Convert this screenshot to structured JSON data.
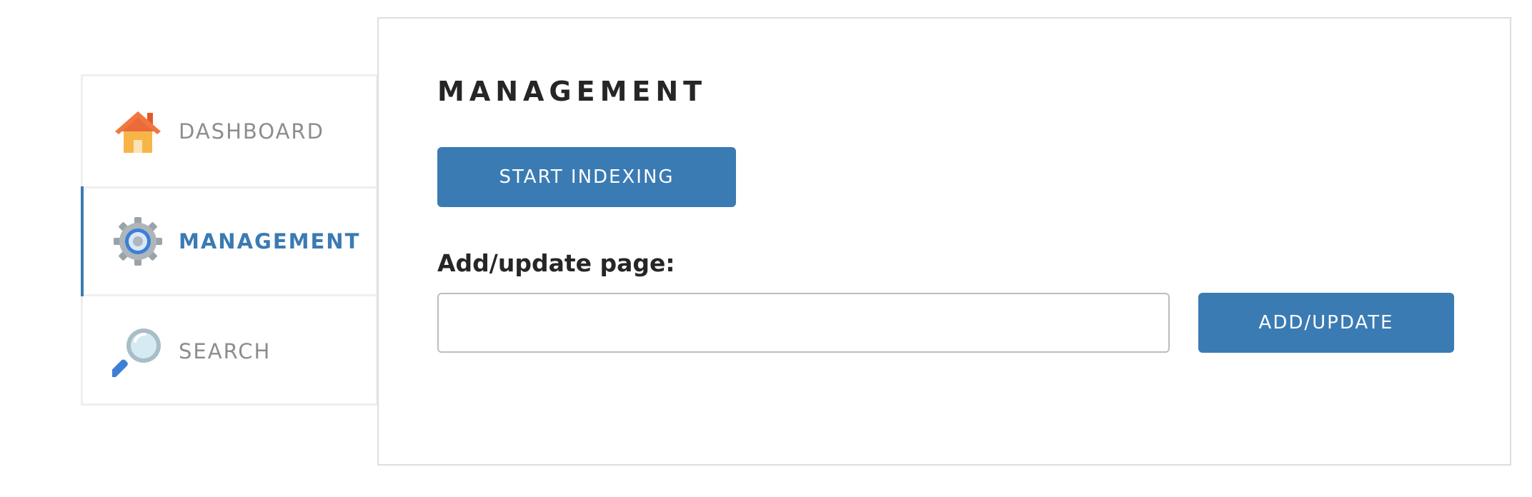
{
  "sidebar": {
    "items": [
      {
        "label": "DASHBOARD",
        "icon": "house-icon",
        "active": false
      },
      {
        "label": "MANAGEMENT",
        "icon": "gear-icon",
        "active": true
      },
      {
        "label": "SEARCH",
        "icon": "magnifier-icon",
        "active": false
      }
    ]
  },
  "main": {
    "title": "MANAGEMENT",
    "start_button_label": "START INDEXING",
    "add_label": "Add/update page:",
    "url_input": {
      "value": "",
      "placeholder": ""
    },
    "add_button_label": "ADD/UPDATE"
  },
  "colors": {
    "accent": "#3a7bb3",
    "inactive_text": "#8d8d8d",
    "heading_text": "#262626",
    "border": "#dedede"
  }
}
